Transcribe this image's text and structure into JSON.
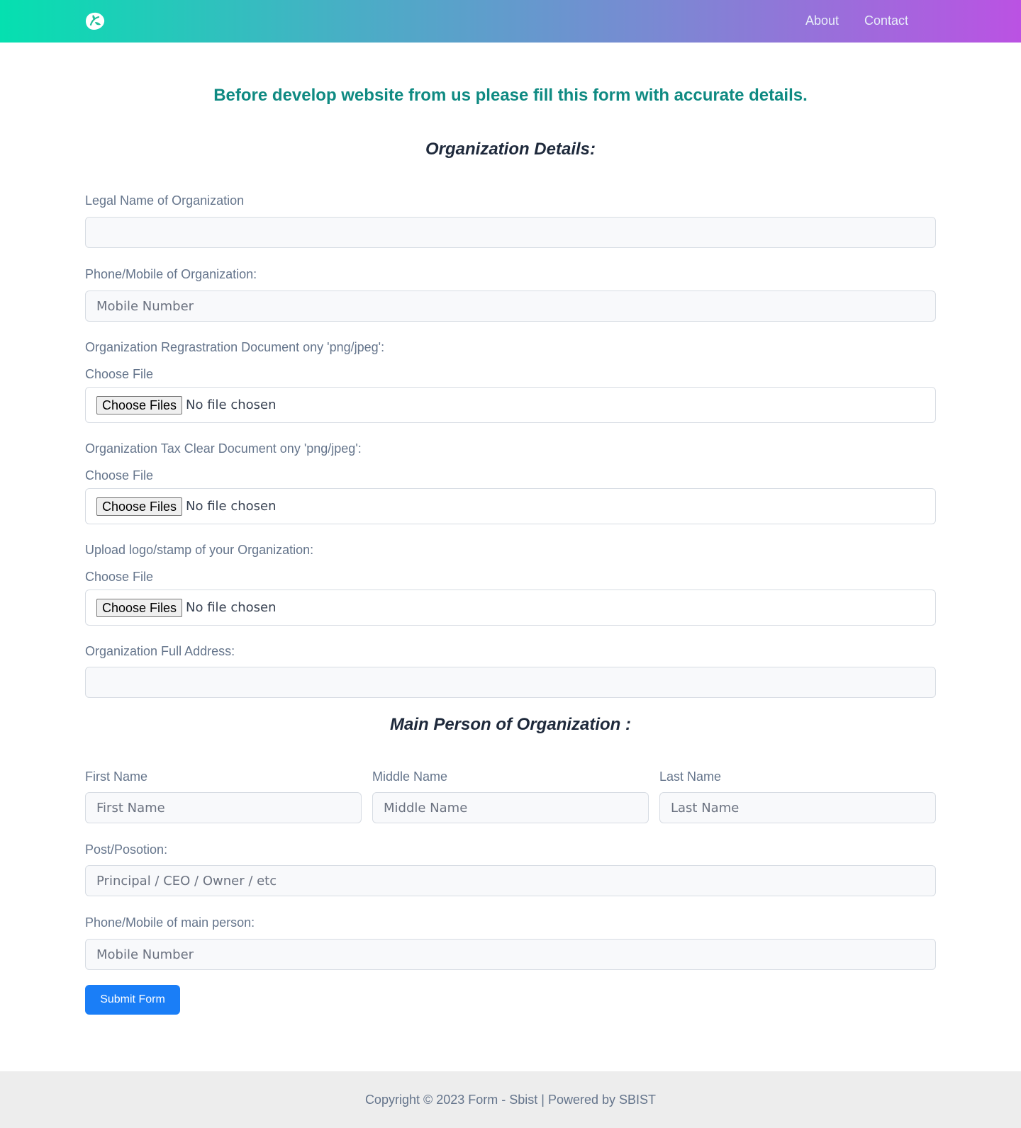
{
  "header": {
    "logo_icon": "leaf-logo-icon",
    "nav": {
      "about": "About",
      "contact": "Contact"
    }
  },
  "intro": "Before develop website from us please fill this form with accurate details.",
  "org_section": {
    "title": "Organization Details:",
    "legal_name": {
      "label": "Legal Name of Organization",
      "placeholder": "",
      "value": ""
    },
    "phone": {
      "label": "Phone/Mobile of Organization:",
      "placeholder": "Mobile Number",
      "value": ""
    },
    "registration_doc": {
      "label": "Organization Regrastration Document ony 'png/jpeg':",
      "sub_label": "Choose File",
      "button": "Choose Files",
      "status": "No file chosen"
    },
    "tax_doc": {
      "label": "Organization Tax Clear Document ony 'png/jpeg':",
      "sub_label": "Choose File",
      "button": "Choose Files",
      "status": "No file chosen"
    },
    "logo_upload": {
      "label": "Upload logo/stamp of your Organization:",
      "sub_label": "Choose File",
      "button": "Choose Files",
      "status": "No file chosen"
    },
    "address": {
      "label": "Organization Full Address:",
      "placeholder": "",
      "value": ""
    }
  },
  "person_section": {
    "title": "Main Person of Organization :",
    "first_name": {
      "label": "First Name",
      "placeholder": "First Name",
      "value": ""
    },
    "middle_name": {
      "label": "Middle Name",
      "placeholder": "Middle Name",
      "value": ""
    },
    "last_name": {
      "label": "Last Name",
      "placeholder": "Last Name",
      "value": ""
    },
    "position": {
      "label": "Post/Posotion:",
      "placeholder": "Principal / CEO / Owner / etc",
      "value": ""
    },
    "phone": {
      "label": "Phone/Mobile of main person:",
      "placeholder": "Mobile Number",
      "value": ""
    }
  },
  "submit_label": "Submit Form",
  "footer": {
    "text": "Copyright © 2023 Form - Sbist | Powered by SBIST"
  },
  "colors": {
    "gradient_start": "#05e0b0",
    "gradient_end": "#bb52e3",
    "intro_text": "#0f8a82",
    "submit_button": "#1a7ef7"
  }
}
